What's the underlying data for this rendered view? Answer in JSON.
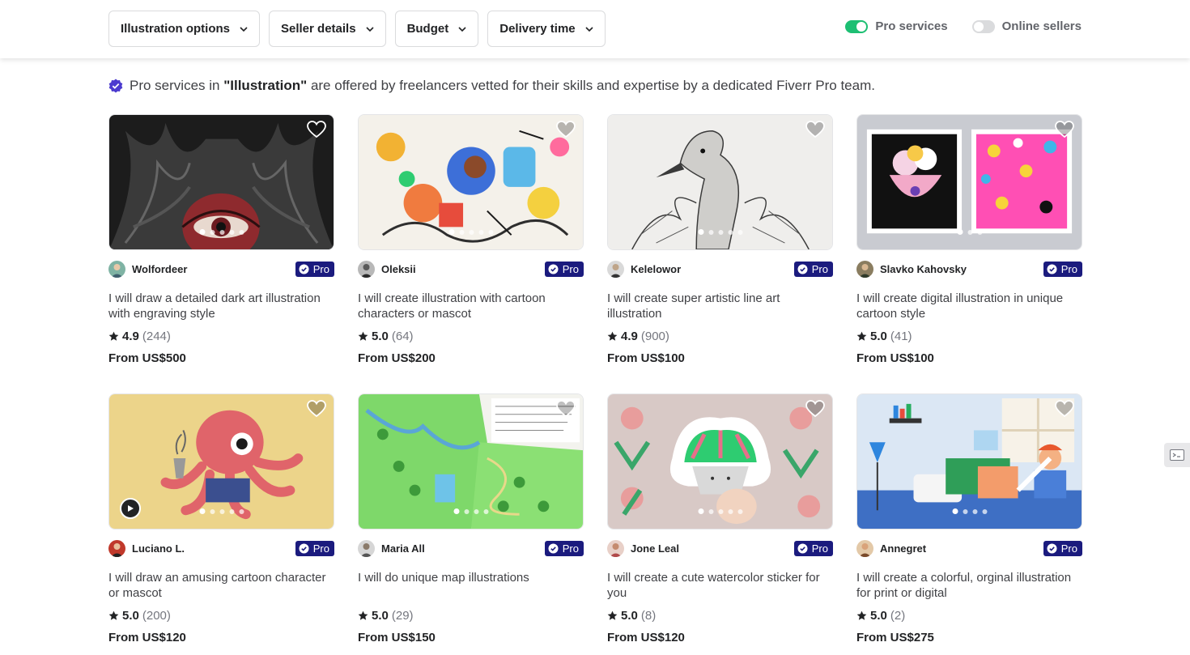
{
  "filters": [
    {
      "label": "Illustration options"
    },
    {
      "label": "Seller details"
    },
    {
      "label": "Budget"
    },
    {
      "label": "Delivery time"
    }
  ],
  "toggles": {
    "pro_services": {
      "label": "Pro services",
      "on": true
    },
    "online_sellers": {
      "label": "Online sellers",
      "on": false
    }
  },
  "pro_note": {
    "prefix": "Pro services in ",
    "category": "\"Illustration\"",
    "suffix": " are offered by freelancers vetted for their skills and expertise by a dedicated Fiverr Pro team."
  },
  "badge_label": "Pro",
  "colors": {
    "accent_green": "#1dbf73",
    "pro_badge": "#1b1b7e",
    "verified": "#4c3bcf"
  },
  "gigs": [
    {
      "seller": "Wolfordeer",
      "title": "I will draw a detailed dark art illustration with engraving style",
      "rating": "4.9",
      "reviews": "(244)",
      "price": "From US$500"
    },
    {
      "seller": "Oleksii",
      "title": "I will create illustration with cartoon characters or mascot",
      "rating": "5.0",
      "reviews": "(64)",
      "price": "From US$200"
    },
    {
      "seller": "Kelelowor",
      "title": "I will create super artistic line art illustration",
      "rating": "4.9",
      "reviews": "(900)",
      "price": "From US$100"
    },
    {
      "seller": "Slavko Kahovsky",
      "title": "I will create digital illustration in unique cartoon style",
      "rating": "5.0",
      "reviews": "(41)",
      "price": "From US$100"
    },
    {
      "seller": "Luciano L.",
      "title": "I will draw an amusing cartoon character or mascot",
      "rating": "5.0",
      "reviews": "(200)",
      "price": "From US$120"
    },
    {
      "seller": "Maria All",
      "title": "I will do unique map illustrations",
      "rating": "5.0",
      "reviews": "(29)",
      "price": "From US$150"
    },
    {
      "seller": "Jone Leal",
      "title": "I will create a cute watercolor sticker for you",
      "rating": "5.0",
      "reviews": "(8)",
      "price": "From US$120"
    },
    {
      "seller": "Annegret",
      "title": "I will create a colorful, orginal illustration for print or digital",
      "rating": "5.0",
      "reviews": "(2)",
      "price": "From US$275"
    }
  ]
}
